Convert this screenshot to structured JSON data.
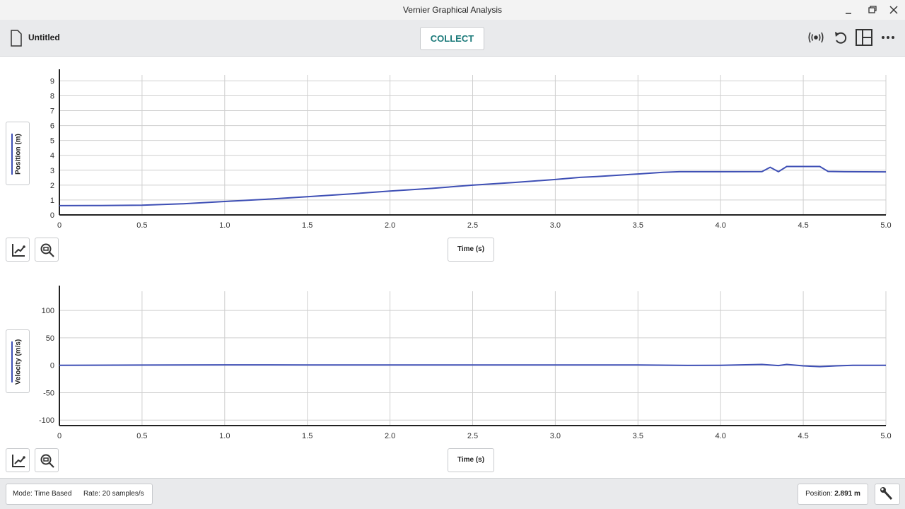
{
  "window": {
    "title": "Vernier Graphical Analysis"
  },
  "toolbar": {
    "doc_title": "Untitled",
    "collect_label": "COLLECT"
  },
  "colors": {
    "series": "#3e4fb5",
    "accent_teal": "#1b7a7a",
    "grid": "#cfcfcf"
  },
  "icons": [
    "document-icon",
    "sensor-broadcast-icon",
    "undo-icon",
    "layout-icon",
    "more-icon",
    "graph-options-icon",
    "zoom-icon",
    "wrench-icon"
  ],
  "graphs": [
    {
      "ylabel": "Position (m)",
      "xlabel": "Time (s)",
      "xticks": [
        "0",
        "0.5",
        "1.0",
        "1.5",
        "2.0",
        "2.5",
        "3.0",
        "3.5",
        "4.0",
        "4.5",
        "5.0"
      ],
      "yticks": [
        "0",
        "1",
        "2",
        "3",
        "4",
        "5",
        "6",
        "7",
        "8",
        "9"
      ]
    },
    {
      "ylabel": "Velocity (m/s)",
      "xlabel": "Time (s)",
      "xticks": [
        "0",
        "0.5",
        "1.0",
        "1.5",
        "2.0",
        "2.5",
        "3.0",
        "3.5",
        "4.0",
        "4.5",
        "5.0"
      ],
      "yticks": [
        "-100",
        "-50",
        "0",
        "50",
        "100"
      ]
    }
  ],
  "footer": {
    "mode": "Mode: Time Based",
    "rate": "Rate: 20 samples/s",
    "position_label": "Position:",
    "position_value": "2.891 m"
  },
  "chart_data": [
    {
      "type": "line",
      "xlabel": "Time (s)",
      "ylabel": "Position (m)",
      "xlim": [
        0,
        5.0
      ],
      "ylim": [
        0,
        9.4
      ],
      "grid": true,
      "series": [
        {
          "x": [
            0,
            0.25,
            0.5,
            0.75,
            1.0,
            1.25,
            1.5,
            1.75,
            2.0,
            2.25,
            2.5,
            2.75,
            3.0,
            3.15,
            3.25,
            3.5,
            3.65,
            3.75,
            4.0,
            4.25,
            4.3,
            4.35,
            4.4,
            4.5,
            4.6,
            4.65,
            4.75,
            5.0
          ],
          "y": [
            0.62,
            0.63,
            0.65,
            0.75,
            0.9,
            1.05,
            1.22,
            1.4,
            1.6,
            1.78,
            2.0,
            2.18,
            2.38,
            2.52,
            2.58,
            2.75,
            2.86,
            2.9,
            2.9,
            2.91,
            3.2,
            2.9,
            3.25,
            3.25,
            3.25,
            2.92,
            2.9,
            2.89
          ]
        }
      ]
    },
    {
      "type": "line",
      "xlabel": "Time (s)",
      "ylabel": "Velocity (m/s)",
      "xlim": [
        0,
        5.0
      ],
      "ylim": [
        -110,
        135
      ],
      "grid": true,
      "series": [
        {
          "x": [
            0,
            0.5,
            1.0,
            1.5,
            2.0,
            2.5,
            3.0,
            3.5,
            3.8,
            4.0,
            4.25,
            4.35,
            4.4,
            4.5,
            4.6,
            4.7,
            4.8,
            5.0
          ],
          "y": [
            0,
            0.4,
            0.8,
            0.7,
            0.6,
            0.6,
            0.7,
            0.5,
            -0.3,
            0,
            1.5,
            -0.5,
            1.5,
            -1.0,
            -2.5,
            -1.0,
            0,
            0
          ]
        }
      ]
    }
  ]
}
